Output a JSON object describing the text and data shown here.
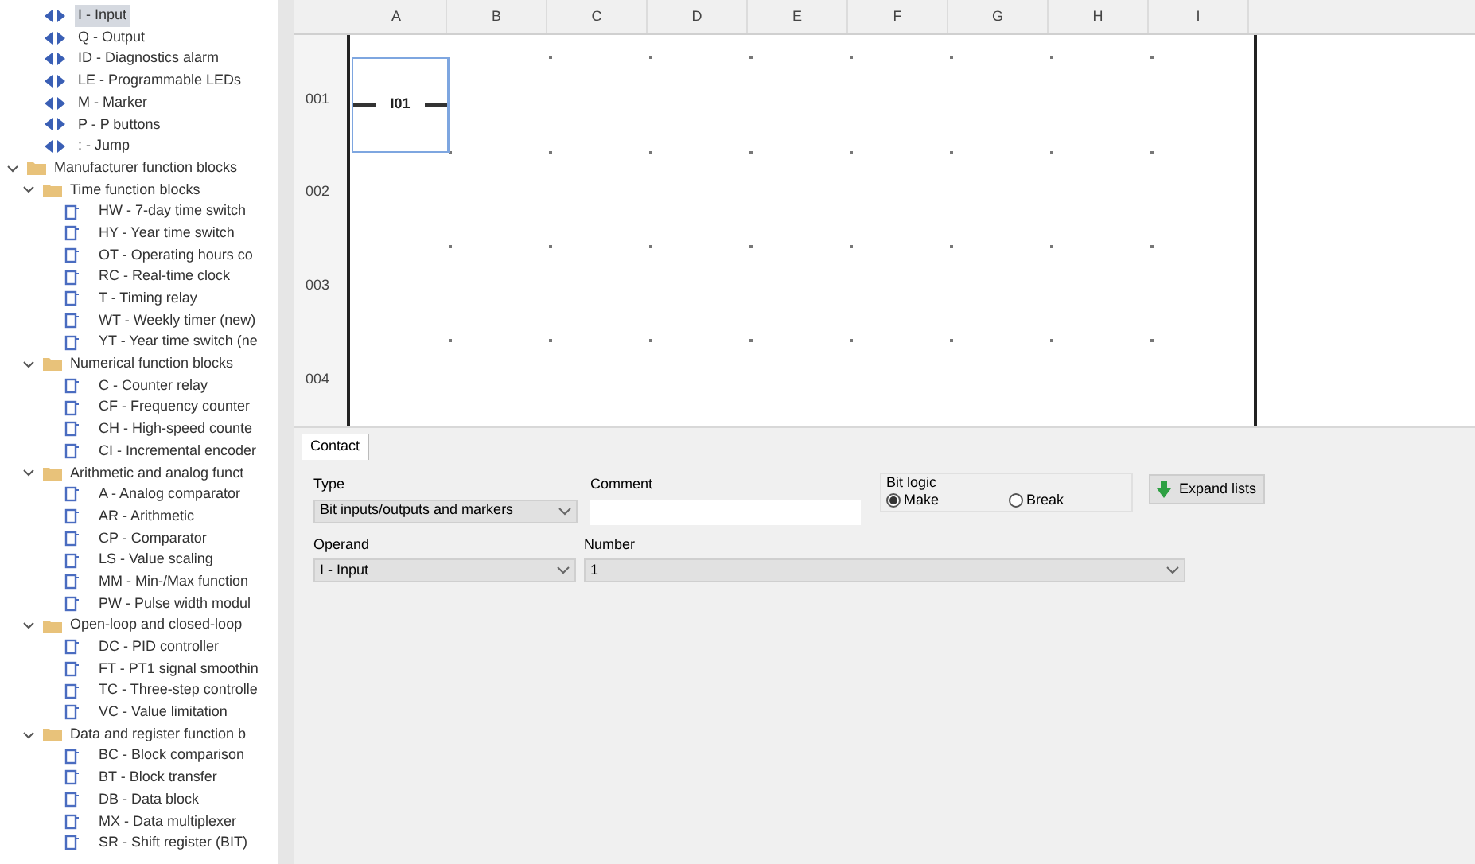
{
  "tree": [
    {
      "kind": "operand",
      "label": "I - Input",
      "selected": true
    },
    {
      "kind": "operand",
      "label": "Q - Output",
      "selected": false
    },
    {
      "kind": "operand",
      "label": "ID - Diagnostics alarm",
      "selected": false
    },
    {
      "kind": "operand",
      "label": "LE - Programmable LEDs",
      "selected": false
    },
    {
      "kind": "operand",
      "label": "M - Marker",
      "selected": false
    },
    {
      "kind": "operand",
      "label": "P - P buttons",
      "selected": false
    },
    {
      "kind": "operand",
      "label": ": - Jump",
      "selected": false
    },
    {
      "kind": "folder",
      "label": "Manufacturer function blocks",
      "expanded": true,
      "children": [
        {
          "kind": "folder",
          "label": "Time function blocks",
          "expanded": true,
          "children": [
            {
              "kind": "block",
              "label": "HW - 7-day time switch"
            },
            {
              "kind": "block",
              "label": "HY - Year time switch"
            },
            {
              "kind": "block",
              "label": "OT - Operating hours co"
            },
            {
              "kind": "block",
              "label": "RC - Real-time clock"
            },
            {
              "kind": "block",
              "label": "T - Timing relay"
            },
            {
              "kind": "block",
              "label": "WT - Weekly timer (new)"
            },
            {
              "kind": "block",
              "label": "YT - Year time switch (ne"
            }
          ]
        },
        {
          "kind": "folder",
          "label": "Numerical function blocks",
          "expanded": true,
          "children": [
            {
              "kind": "block",
              "label": "C - Counter relay"
            },
            {
              "kind": "block",
              "label": "CF - Frequency counter"
            },
            {
              "kind": "block",
              "label": "CH - High-speed counte"
            },
            {
              "kind": "block",
              "label": "CI - Incremental encoder"
            }
          ]
        },
        {
          "kind": "folder",
          "label": "Arithmetic and analog funct",
          "expanded": true,
          "children": [
            {
              "kind": "block",
              "label": "A - Analog comparator"
            },
            {
              "kind": "block",
              "label": "AR - Arithmetic"
            },
            {
              "kind": "block",
              "label": "CP - Comparator"
            },
            {
              "kind": "block",
              "label": "LS - Value scaling"
            },
            {
              "kind": "block",
              "label": "MM - Min-/Max function"
            },
            {
              "kind": "block",
              "label": "PW - Pulse width modul"
            }
          ]
        },
        {
          "kind": "folder",
          "label": "Open-loop and closed-loop",
          "expanded": true,
          "children": [
            {
              "kind": "block",
              "label": "DC - PID controller"
            },
            {
              "kind": "block",
              "label": "FT - PT1 signal smoothin"
            },
            {
              "kind": "block",
              "label": "TC - Three-step controlle"
            },
            {
              "kind": "block",
              "label": "VC - Value limitation"
            }
          ]
        },
        {
          "kind": "folder",
          "label": "Data and register function b",
          "expanded": true,
          "children": [
            {
              "kind": "block",
              "label": "BC - Block comparison"
            },
            {
              "kind": "block",
              "label": "BT - Block transfer"
            },
            {
              "kind": "block",
              "label": "DB - Data block"
            },
            {
              "kind": "block",
              "label": "MX - Data multiplexer"
            },
            {
              "kind": "block",
              "label": "SR - Shift register (BIT)"
            }
          ]
        }
      ]
    }
  ],
  "diagram": {
    "columns": [
      "A",
      "B",
      "C",
      "D",
      "E",
      "F",
      "G",
      "H",
      "I"
    ],
    "rows": [
      "001",
      "002",
      "003",
      "004"
    ],
    "contact": {
      "label": "I01",
      "selected": true
    }
  },
  "properties": {
    "tabs": [
      {
        "label": "Contact",
        "selected": true
      }
    ],
    "type": {
      "label": "Type",
      "value": "Bit inputs/outputs and markers"
    },
    "comment": {
      "label": "Comment"
    },
    "bit_logic": {
      "label": "Bit logic",
      "options": [
        {
          "label": "Make",
          "selected": true
        },
        {
          "label": "Break",
          "selected": false
        }
      ]
    },
    "expand_button": "Expand lists",
    "operand": {
      "label": "Operand",
      "value": "I - Input"
    },
    "number": {
      "label": "Number",
      "value": "1"
    }
  }
}
